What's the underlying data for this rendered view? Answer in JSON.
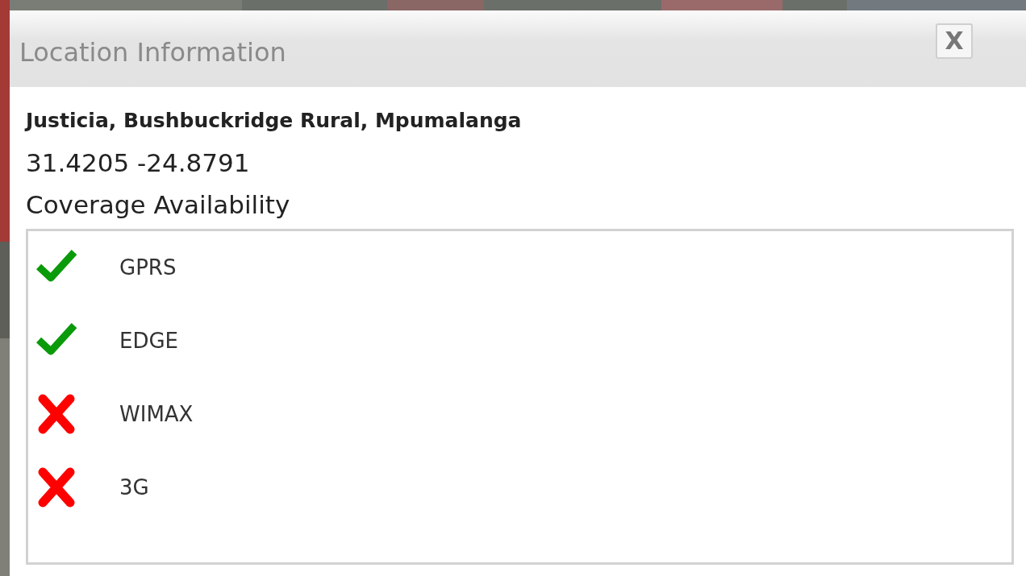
{
  "dialog": {
    "title": "Location Information",
    "close_label": "X"
  },
  "place": "Justicia, Bushbuckridge Rural, Mpumalanga",
  "coordinates": "31.4205 -24.8791",
  "coverage": {
    "heading": "Coverage Availability",
    "items": [
      {
        "name": "GPRS",
        "available": true
      },
      {
        "name": "EDGE",
        "available": true
      },
      {
        "name": "WIMAX",
        "available": false
      },
      {
        "name": "3G",
        "available": false
      }
    ]
  }
}
